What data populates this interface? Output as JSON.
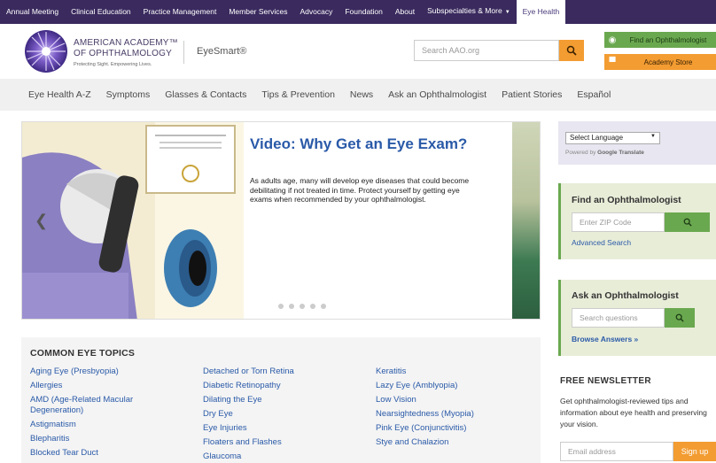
{
  "topbar": {
    "items": [
      "Annual Meeting",
      "Clinical Education",
      "Practice Management",
      "Member Services",
      "Advocacy",
      "Foundation",
      "About",
      "Subspecialties & More",
      "Eye Health"
    ],
    "caret": "▼"
  },
  "header": {
    "org_line1": "AMERICAN ACADEMY™",
    "org_line2": "OF OPHTHALMOLOGY",
    "tagline": "Protecting Sight. Empowering Lives.",
    "eyesmart": "EyeSmart®",
    "search_placeholder": "Search AAO.org",
    "find_label": "Find an Ophthalmologist",
    "store_label": "Academy Store"
  },
  "nav": {
    "items": [
      "Eye Health A-Z",
      "Symptoms",
      "Glasses & Contacts",
      "Tips & Prevention",
      "News",
      "Ask an Ophthalmologist",
      "Patient Stories",
      "Español"
    ]
  },
  "hero": {
    "title": "Video: Why Get an Eye Exam?",
    "text": "As adults age, many will develop eye diseases that could become debilitating if not treated in time. Protect yourself by getting eye exams when recommended by your ophthalmologist."
  },
  "topics": {
    "title": "COMMON EYE TOPICS",
    "col1": [
      "Aging Eye (Presbyopia)",
      "Allergies",
      "AMD (Age-Related Macular Degeneration)",
      "Astigmatism",
      "Blepharitis",
      "Blocked Tear Duct"
    ],
    "col2": [
      "Detached or Torn Retina",
      "Diabetic Retinopathy",
      "Dilating the Eye",
      "Dry Eye",
      "Eye Injuries",
      "Floaters and Flashes",
      "Glaucoma"
    ],
    "col3": [
      "Keratitis",
      "Lazy Eye (Amblyopia)",
      "Low Vision",
      "Nearsightedness (Myopia)",
      "Pink Eye (Conjunctivitis)",
      "Stye and Chalazion"
    ]
  },
  "sidebar": {
    "lang_select": "Select Language",
    "lang_powered": "Powered by",
    "lang_google": "Google Translate",
    "find_title": "Find an Ophthalmologist",
    "zip_placeholder": "Enter ZIP Code",
    "advanced": "Advanced Search",
    "ask_title": "Ask an Ophthalmologist",
    "ask_placeholder": "Search questions",
    "browse": "Browse Answers »",
    "nl_title": "FREE NEWSLETTER",
    "nl_text": "Get ophthalmologist-reviewed tips and information about eye health and preserving your vision.",
    "email_placeholder": "Email address",
    "signup": "Sign up"
  },
  "colors": {
    "topbar": "#3a2a5e",
    "accent_orange": "#f39c32",
    "accent_green": "#6aa84f",
    "link_blue": "#2a5aa8"
  }
}
